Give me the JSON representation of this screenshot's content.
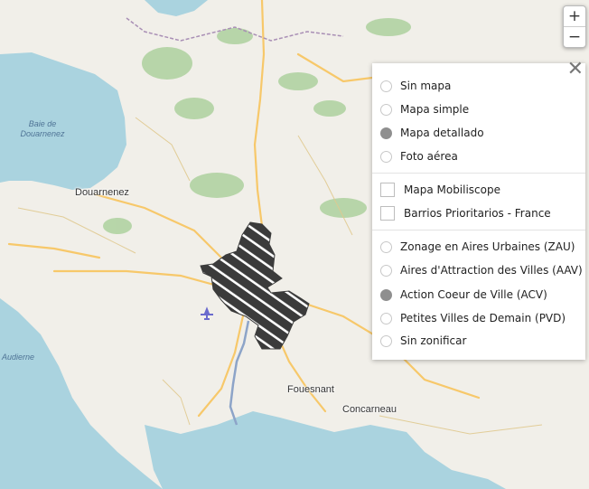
{
  "map": {
    "places": [
      "Douarnenez",
      "Fouesnant",
      "Concarneau"
    ],
    "sea_labels": [
      "Baie de Douarnenez",
      "Audierne"
    ],
    "zone_color": "#3b3b3b",
    "zone_hatch_color": "#ffffff",
    "sea_color": "#aad3df",
    "land_color": "#f1efe9",
    "forest_color": "#add19e",
    "road_color": "#f7c86a",
    "airport_icon": "airplane-icon"
  },
  "zoom": {
    "in": "+",
    "out": "−"
  },
  "layer_panel": {
    "close": "✕",
    "basemaps": [
      {
        "label": "Sin mapa",
        "checked": false
      },
      {
        "label": "Mapa simple",
        "checked": false
      },
      {
        "label": "Mapa detallado",
        "checked": true
      },
      {
        "label": "Foto aérea",
        "checked": false
      }
    ],
    "overlays": [
      {
        "label": "Mapa Mobiliscope",
        "checked": false
      },
      {
        "label": "Barrios Prioritarios - France",
        "checked": false
      }
    ],
    "zonings": [
      {
        "label": "Zonage en Aires Urbaines (ZAU)",
        "checked": false
      },
      {
        "label": "Aires d'Attraction des Villes (AAV)",
        "checked": false
      },
      {
        "label": "Action Coeur de Ville (ACV)",
        "checked": true
      },
      {
        "label": "Petites Villes de Demain (PVD)",
        "checked": false
      },
      {
        "label": "Sin zonificar",
        "checked": false
      }
    ]
  }
}
